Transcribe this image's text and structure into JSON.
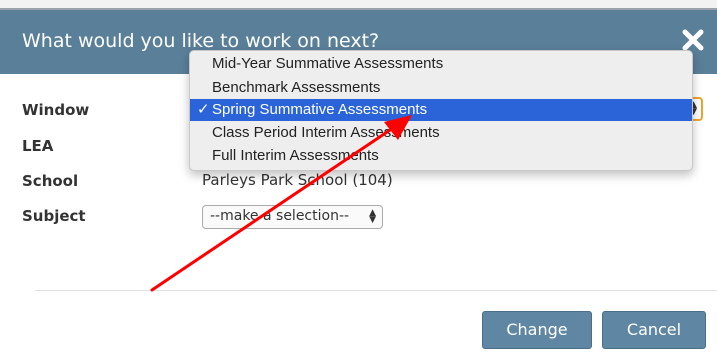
{
  "modal": {
    "title": "What would you like to work on next?",
    "close_icon": "close-x-icon"
  },
  "form": {
    "window_label": "Window",
    "lea_label": "LEA",
    "school_label": "School",
    "school_value": "Parleys Park School (104)",
    "subject_label": "Subject",
    "subject_value": "--make a selection--"
  },
  "dropdown": {
    "items": [
      {
        "label": "Mid-Year Summative Assessments",
        "selected": false
      },
      {
        "label": "Benchmark Assessments",
        "selected": false
      },
      {
        "label": "Spring Summative Assessments",
        "selected": true
      },
      {
        "label": "Class Period Interim Assessments",
        "selected": false
      },
      {
        "label": "Full Interim Assessments",
        "selected": false
      }
    ],
    "check": "✓"
  },
  "buttons": {
    "change_label": "Change",
    "cancel_label": "Cancel"
  },
  "colors": {
    "header": "#5a7f99",
    "button": "#5f87a3",
    "selection": "#2b64d8",
    "focus_ring": "#f0a42b",
    "annotation_arrow": "#ff0000"
  }
}
